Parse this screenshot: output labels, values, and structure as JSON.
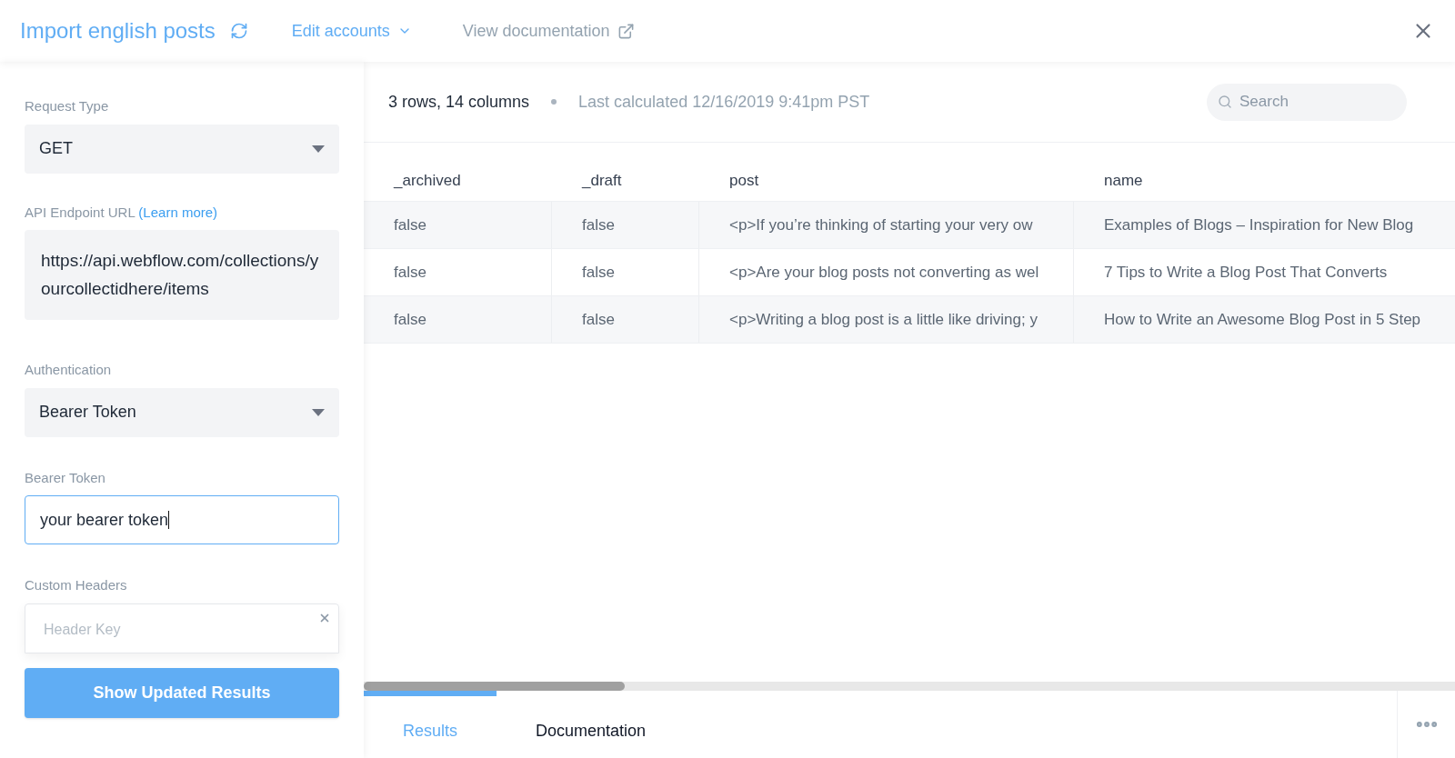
{
  "header": {
    "title": "Import english posts",
    "menu": "Edit accounts",
    "doc_link": "View documentation"
  },
  "form": {
    "request_type": {
      "label": "Request Type",
      "value": "GET"
    },
    "endpoint": {
      "label": "API Endpoint URL",
      "link": "(Learn more)",
      "value": "https://api.webflow.com/collections/yourcollectidhere/items"
    },
    "authentication": {
      "label": "Authentication",
      "value": "Bearer Token"
    },
    "bearer_token": {
      "label": "Bearer Token",
      "value": "your bearer token",
      "focused": true
    },
    "custom_headers": {
      "label": "Custom Headers",
      "key_placeholder": "Header Key"
    },
    "submit": "Show Updated Results"
  },
  "summary": {
    "counts": "3 rows, 14 columns",
    "last_calculated": "Last calculated 12/16/2019 9:41pm PST"
  },
  "search": {
    "placeholder": "Search"
  },
  "table": {
    "columns": [
      "_archived",
      "_draft",
      "post",
      "name"
    ],
    "rows": [
      [
        "false",
        "false",
        "<p>If you’re thinking of starting your very ow",
        "Examples of Blogs – Inspiration for New Blog"
      ],
      [
        "false",
        "false",
        "<p>Are your blog posts not converting as wel",
        "7 Tips to Write a Blog Post That Converts"
      ],
      [
        "false",
        "false",
        "<p>Writing a blog post is a little like driving; y",
        "How to Write an Awesome Blog Post in 5 Step"
      ]
    ]
  },
  "tabs": [
    {
      "label": "Results",
      "selected": true
    },
    {
      "label": "Documentation",
      "selected": false
    }
  ]
}
